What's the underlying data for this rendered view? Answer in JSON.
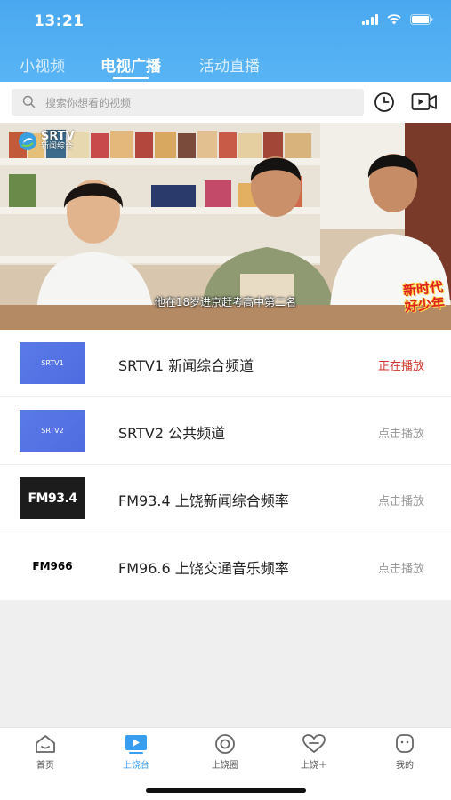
{
  "status_bar": {
    "time": "13:21"
  },
  "top_tabs": [
    {
      "label": "小视频",
      "active": false
    },
    {
      "label": "电视广播",
      "active": true
    },
    {
      "label": "活动直播",
      "active": false
    }
  ],
  "search": {
    "placeholder": "搜索你想看的视频"
  },
  "player": {
    "logo_title": "SRTV",
    "logo_subtitle": "新闻综合",
    "subtitle": "他在18岁进京赶考高中第二名",
    "badge_line1": "新时代",
    "badge_line2": "好少年"
  },
  "channels": [
    {
      "thumb_text": "SRTV1",
      "name": "SRTV1 新闻综合频道",
      "action": "正在播放",
      "playing": true
    },
    {
      "thumb_text": "SRTV2",
      "name": "SRTV2 公共频道",
      "action": "点击播放",
      "playing": false
    },
    {
      "thumb_text": "FM93.4",
      "name": "FM93.4 上饶新闻综合频率",
      "action": "点击播放",
      "playing": false
    },
    {
      "thumb_text": "FM966",
      "name": "FM96.6 上饶交通音乐频率",
      "action": "点击播放",
      "playing": false
    }
  ],
  "bottom_nav": [
    {
      "label": "首页",
      "icon": "home-icon",
      "active": false
    },
    {
      "label": "上饶台",
      "icon": "tv-play-icon",
      "active": true
    },
    {
      "label": "上饶圈",
      "icon": "circle-icon",
      "active": false
    },
    {
      "label": "上饶＋",
      "icon": "heart-icon",
      "active": false
    },
    {
      "label": "我的",
      "icon": "profile-icon",
      "active": false
    }
  ],
  "colors": {
    "header_blue": "#4aa8f0",
    "active_nav": "#3a9ef0",
    "playing_red": "#d0342c"
  }
}
